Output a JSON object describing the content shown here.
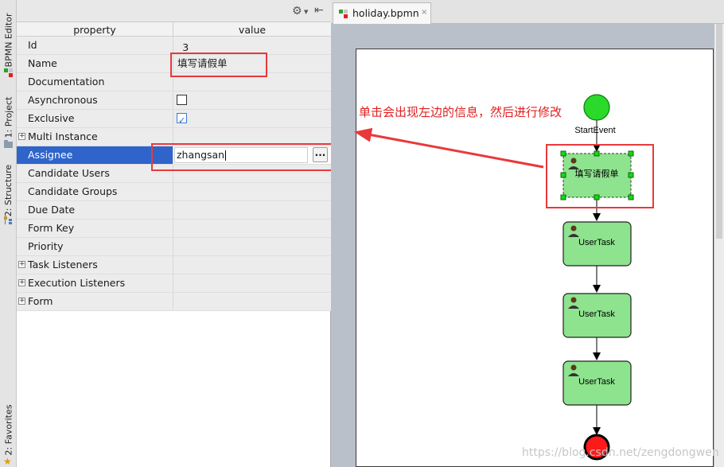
{
  "side_tabs": {
    "bpmn_editor": "BPMN Editor",
    "project": "1: Project",
    "structure": "2: Structure",
    "favorites": "2: Favorites"
  },
  "panel": {
    "columns": {
      "property": "property",
      "value": "value"
    },
    "rows": [
      {
        "key": "Id",
        "value": "_3"
      },
      {
        "key": "Name",
        "value": "填写请假单"
      },
      {
        "key": "Documentation",
        "value": ""
      },
      {
        "key": "Asynchronous",
        "checked": false
      },
      {
        "key": "Exclusive",
        "checked": true
      },
      {
        "key": "Multi Instance",
        "expandable": true
      },
      {
        "key": "Assignee",
        "value": "zhangsan",
        "selected": true
      },
      {
        "key": "Candidate Users",
        "value": ""
      },
      {
        "key": "Candidate Groups",
        "value": ""
      },
      {
        "key": "Due Date",
        "value": ""
      },
      {
        "key": "Form Key",
        "value": ""
      },
      {
        "key": "Priority",
        "value": ""
      },
      {
        "key": "Task Listeners",
        "expandable": true
      },
      {
        "key": "Execution Listeners",
        "expandable": true
      },
      {
        "key": "Form",
        "expandable": true
      }
    ],
    "ellipsis_label": "...",
    "expand_glyph": "+"
  },
  "editor": {
    "tab_label": "holiday.bpmn",
    "tab_close": "×"
  },
  "diagram": {
    "start_label": "StartEvent",
    "tasks": [
      "填写请假单",
      "UserTask",
      "UserTask",
      "UserTask"
    ]
  },
  "annotation": "单击会出现左边的信息，然后进行修改",
  "watermark": "https://blog.csdn.net/zengdongwen",
  "colors": {
    "selection": "#2f65ca",
    "highlight_red": "#e8393b",
    "task_fill": "#8ee38e",
    "start_fill": "#2bd92b",
    "end_fill": "#ff1a1a"
  }
}
